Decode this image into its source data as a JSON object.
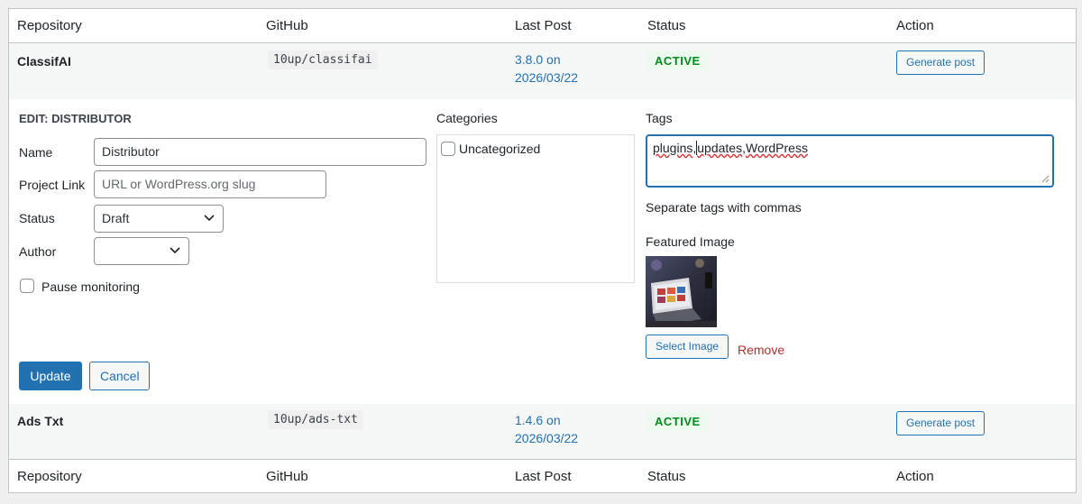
{
  "columns": [
    "Repository",
    "GitHub",
    "Last Post",
    "Status",
    "Action"
  ],
  "rows": [
    {
      "name": "ClassifAI",
      "github": "10up/classifai",
      "last_post_line1": "3.8.0 on",
      "last_post_line2": "2026/03/22",
      "status": "ACTIVE",
      "action": "Generate post"
    },
    {
      "name": "Ads Txt",
      "github": "10up/ads-txt",
      "last_post_line1": "1.4.6 on",
      "last_post_line2": "2026/03/22",
      "status": "ACTIVE",
      "action": "Generate post"
    }
  ],
  "edit": {
    "heading": "EDIT: DISTRIBUTOR",
    "name_label": "Name",
    "name_value": "Distributor",
    "project_link_label": "Project Link",
    "project_link_placeholder": "URL or WordPress.org slug",
    "status_label": "Status",
    "status_value": "Draft",
    "author_label": "Author",
    "author_value": "",
    "pause_label": "Pause monitoring",
    "categories_label": "Categories",
    "category_item": "Uncategorized",
    "tags_label": "Tags",
    "tags_value_a": "plugins",
    "tags_sep": ",",
    "tags_value_b": "updates",
    "tags_value_c": "WordPress",
    "tags_hint": "Separate tags with commas",
    "featured_label": "Featured Image",
    "select_image": "Select Image",
    "remove": "Remove",
    "update": "Update",
    "cancel": "Cancel"
  },
  "colors": {
    "accent": "#2271b1",
    "active_badge_bg": "#edfaef",
    "active_badge_text": "#008a20",
    "remove": "#b32d2e"
  }
}
